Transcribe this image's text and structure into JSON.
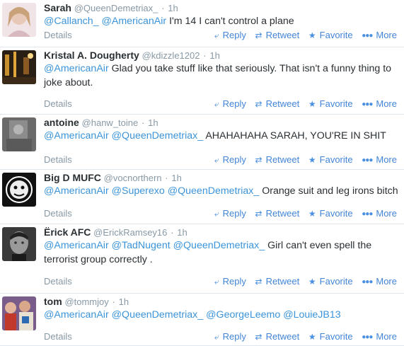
{
  "actions": {
    "reply": "Reply",
    "retweet": "Retweet",
    "favorite": "Favorite",
    "more": "More",
    "details": "Details"
  },
  "icons": {
    "reply": "reply-arrow-icon",
    "retweet": "retweet-icon",
    "favorite": "star-icon",
    "more": "ellipsis-icon"
  },
  "separator": "·",
  "tweets": [
    {
      "name": "Sarah",
      "handle": "@QueenDemetriax_",
      "time": "1h",
      "text": [
        {
          "m": "@Callanch_"
        },
        {
          "t": " "
        },
        {
          "m": "@AmericanAir"
        },
        {
          "t": " I'm 14 I can't control a plane"
        }
      ]
    },
    {
      "name": "Kristal A. Dougherty",
      "handle": "@kdizzle1202",
      "time": "1h",
      "text": [
        {
          "m": "@AmericanAir"
        },
        {
          "t": " Glad you take stuff like that seriously. That isn't a funny thing to joke about."
        }
      ]
    },
    {
      "name": "antoine",
      "handle": "@hanw_toine",
      "time": "1h",
      "text": [
        {
          "m": "@AmericanAir"
        },
        {
          "t": " "
        },
        {
          "m": "@QueenDemetriax_"
        },
        {
          "t": " AHAHAHAHA SARAH, YOU'RE IN SHIT"
        }
      ]
    },
    {
      "name": "Big D MUFC",
      "handle": "@vocnorthern",
      "time": "1h",
      "text": [
        {
          "m": "@AmericanAir"
        },
        {
          "t": " "
        },
        {
          "m": "@Superexo"
        },
        {
          "t": " "
        },
        {
          "m": "@QueenDemetriax_"
        },
        {
          "t": "  Orange suit and leg irons bitch"
        }
      ]
    },
    {
      "name": "Ërick AFC",
      "handle": "@ErickRamsey16",
      "time": "1h",
      "text": [
        {
          "m": "@AmericanAir"
        },
        {
          "t": " "
        },
        {
          "m": "@TadNugent"
        },
        {
          "t": " "
        },
        {
          "m": "@QueenDemetriax_"
        },
        {
          "t": " Girl can't even spell the terrorist group correctly ."
        }
      ]
    },
    {
      "name": "tom",
      "handle": "@tommjoy",
      "time": "1h",
      "text": [
        {
          "m": "@AmericanAir"
        },
        {
          "t": " "
        },
        {
          "m": "@QueenDemetriax_"
        },
        {
          "t": " "
        },
        {
          "m": "@GeorgeLeemo"
        },
        {
          "t": " "
        },
        {
          "m": "@LouieJB13"
        }
      ]
    }
  ],
  "colors": {
    "link": "#3b94d9",
    "muted": "#8899a6",
    "action": "#4385d8",
    "divider": "#e1e8ed",
    "text": "#292f33"
  }
}
